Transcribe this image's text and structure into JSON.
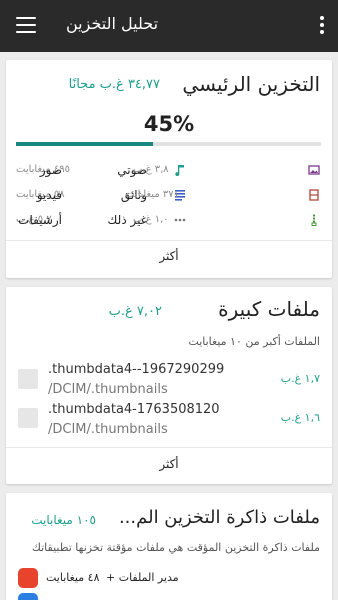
{
  "appbar": {
    "title": "تحليل التخزين",
    "menu_icon": "hamburger-menu-icon",
    "more_icon": "more-vertical-icon"
  },
  "colors": {
    "appbar_bg": "#2a2a2a",
    "accent": "#1e9e8c",
    "progress_fill": "#16887d"
  },
  "main_storage": {
    "title": "التخزين الرئيسي",
    "free": "٣٤,٧٧ غ.ب مجانًا",
    "used_percent_label": "45%",
    "used_fraction": 0.45,
    "categories": [
      {
        "label": "صوتي",
        "size": "٤٩٥ ميغابايت",
        "icon": "music-note-icon"
      },
      {
        "label": "صور",
        "size": "٣,٨ غ.ب",
        "icon": "image-icon"
      },
      {
        "label": "وثائق",
        "size": "٥٨ ميغابايت",
        "icon": "document-lines-icon"
      },
      {
        "label": "فيديو",
        "size": "٣٧١ ميغابايت",
        "icon": "film-icon"
      },
      {
        "label": "غير ذلك",
        "size": "٥,٧ غ.ب",
        "icon": "dots-horizontal-icon"
      },
      {
        "label": "أرشيفات",
        "size": "١,٠ غ.ب",
        "icon": "archive-zipper-icon"
      }
    ],
    "more_label": "أكثر"
  },
  "large_files": {
    "title": "ملفات كبيرة",
    "total": "٧,٠٢ غ.ب",
    "description": "الملفات أكبر من ١٠ ميغابايت",
    "files": [
      {
        "name": ".thumbdata4--1967290299",
        "path": "/DCIM/.thumbnails",
        "size": "١,٧ غ.ب"
      },
      {
        "name": ".thumbdata4-1763508120",
        "path": "/DCIM/.thumbnails",
        "size": "١,٦ غ.ب"
      }
    ],
    "more_label": "أكثر"
  },
  "cache": {
    "title": "ملفات ذاكرة التخزين الم...",
    "total": "١٠٥ ميغابايت",
    "description": "ملفات ذاكرة التخزين المؤقت هي ملفات مؤقتة تخزنها تطبيقاتك",
    "apps": [
      {
        "name": "مدير الملفات +",
        "size": "٤٨ ميغابايت"
      }
    ]
  }
}
